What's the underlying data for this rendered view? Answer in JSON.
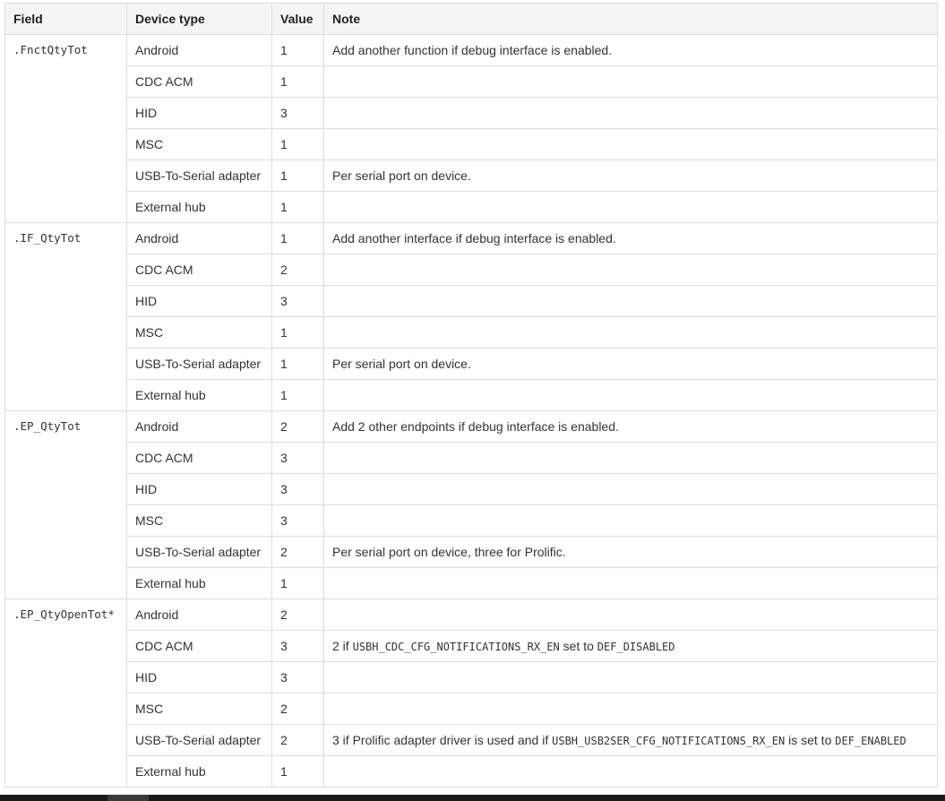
{
  "table": {
    "headers": {
      "field": "Field",
      "device_type": "Device type",
      "value": "Value",
      "note": "Note"
    },
    "groups": [
      {
        "field": ".FnctQtyTot",
        "rows": [
          {
            "device": "Android",
            "value": "1",
            "note": "Add another function if debug interface is enabled."
          },
          {
            "device": "CDC ACM",
            "value": "1",
            "note": ""
          },
          {
            "device": "HID",
            "value": "3",
            "note": ""
          },
          {
            "device": "MSC",
            "value": "1",
            "note": ""
          },
          {
            "device": "USB-To-Serial adapter",
            "value": "1",
            "note": "Per serial port on device."
          },
          {
            "device": "External hub",
            "value": "1",
            "note": ""
          }
        ]
      },
      {
        "field": ".IF_QtyTot",
        "rows": [
          {
            "device": "Android",
            "value": "1",
            "note": "Add another interface if debug interface is enabled."
          },
          {
            "device": "CDC ACM",
            "value": "2",
            "note": ""
          },
          {
            "device": "HID",
            "value": "3",
            "note": ""
          },
          {
            "device": "MSC",
            "value": "1",
            "note": ""
          },
          {
            "device": "USB-To-Serial adapter",
            "value": "1",
            "note": "Per serial port on device."
          },
          {
            "device": "External hub",
            "value": "1",
            "note": ""
          }
        ]
      },
      {
        "field": ".EP_QtyTot",
        "rows": [
          {
            "device": "Android",
            "value": "2",
            "note": "Add 2 other endpoints if debug interface is enabled."
          },
          {
            "device": "CDC ACM",
            "value": "3",
            "note": ""
          },
          {
            "device": "HID",
            "value": "3",
            "note": ""
          },
          {
            "device": "MSC",
            "value": "3",
            "note": ""
          },
          {
            "device": "USB-To-Serial adapter",
            "value": "2",
            "note": "Per serial port on device, three for Prolific."
          },
          {
            "device": "External hub",
            "value": "1",
            "note": ""
          }
        ]
      },
      {
        "field": ".EP_QtyOpenTot*",
        "rows": [
          {
            "device": "Android",
            "value": "2",
            "note": ""
          },
          {
            "device": "CDC ACM",
            "value": "3",
            "note_parts": [
              {
                "text": "2 if ",
                "code": false
              },
              {
                "text": "USBH_CDC_CFG_NOTIFICATIONS_RX_EN",
                "code": true
              },
              {
                "text": " set to ",
                "code": false
              },
              {
                "text": "DEF_DISABLED",
                "code": true
              }
            ]
          },
          {
            "device": "HID",
            "value": "3",
            "note": ""
          },
          {
            "device": "MSC",
            "value": "2",
            "note": ""
          },
          {
            "device": "USB-To-Serial adapter",
            "value": "2",
            "note_parts": [
              {
                "text": "3 if Prolific adapter driver is used and if ",
                "code": false
              },
              {
                "text": "USBH_USB2SER_CFG_NOTIFICATIONS_RX_EN",
                "code": true
              },
              {
                "text": " is set to ",
                "code": false
              },
              {
                "text": "DEF_ENABLED",
                "code": true
              }
            ]
          },
          {
            "device": "External hub",
            "value": "1",
            "note": ""
          }
        ]
      }
    ]
  }
}
